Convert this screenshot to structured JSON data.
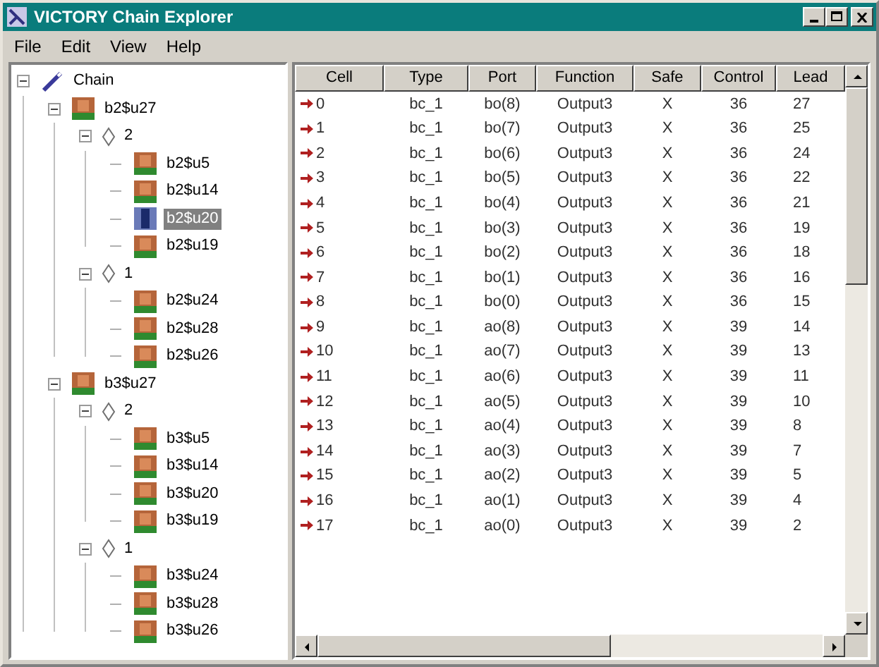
{
  "window": {
    "title": "VICTORY Chain Explorer"
  },
  "menu": [
    "File",
    "Edit",
    "View",
    "Help"
  ],
  "tree": [
    {
      "label": "Chain",
      "kind": "chain",
      "expanded": true,
      "selected": false,
      "children": [
        {
          "label": "b2$u27",
          "kind": "chip",
          "expanded": true,
          "selected": false,
          "children": [
            {
              "label": "2",
              "kind": "group",
              "expanded": true,
              "selected": false,
              "children": [
                {
                  "label": "b2$u5",
                  "kind": "chip",
                  "selected": false
                },
                {
                  "label": "b2$u14",
                  "kind": "chip",
                  "selected": false
                },
                {
                  "label": "b2$u20",
                  "kind": "chip",
                  "selected": true
                },
                {
                  "label": "b2$u19",
                  "kind": "chip",
                  "selected": false
                }
              ]
            },
            {
              "label": "1",
              "kind": "group",
              "expanded": true,
              "selected": false,
              "children": [
                {
                  "label": "b2$u24",
                  "kind": "chip",
                  "selected": false
                },
                {
                  "label": "b2$u28",
                  "kind": "chip",
                  "selected": false
                },
                {
                  "label": "b2$u26",
                  "kind": "chip",
                  "selected": false
                }
              ]
            }
          ]
        },
        {
          "label": "b3$u27",
          "kind": "chip",
          "expanded": true,
          "selected": false,
          "children": [
            {
              "label": "2",
              "kind": "group",
              "expanded": true,
              "selected": false,
              "children": [
                {
                  "label": "b3$u5",
                  "kind": "chip",
                  "selected": false
                },
                {
                  "label": "b3$u14",
                  "kind": "chip",
                  "selected": false
                },
                {
                  "label": "b3$u20",
                  "kind": "chip",
                  "selected": false
                },
                {
                  "label": "b3$u19",
                  "kind": "chip",
                  "selected": false
                }
              ]
            },
            {
              "label": "1",
              "kind": "group",
              "expanded": true,
              "selected": false,
              "children": [
                {
                  "label": "b3$u24",
                  "kind": "chip",
                  "selected": false
                },
                {
                  "label": "b3$u28",
                  "kind": "chip",
                  "selected": false
                },
                {
                  "label": "b3$u26",
                  "kind": "chip",
                  "selected": false
                }
              ]
            }
          ]
        }
      ]
    }
  ],
  "table": {
    "columns": [
      "Cell",
      "Type",
      "Port",
      "Function",
      "Safe",
      "Control",
      "Lead"
    ],
    "rows": [
      [
        "0",
        "bc_1",
        "bo(8)",
        "Output3",
        "X",
        "36",
        "27"
      ],
      [
        "1",
        "bc_1",
        "bo(7)",
        "Output3",
        "X",
        "36",
        "25"
      ],
      [
        "2",
        "bc_1",
        "bo(6)",
        "Output3",
        "X",
        "36",
        "24"
      ],
      [
        "3",
        "bc_1",
        "bo(5)",
        "Output3",
        "X",
        "36",
        "22"
      ],
      [
        "4",
        "bc_1",
        "bo(4)",
        "Output3",
        "X",
        "36",
        "21"
      ],
      [
        "5",
        "bc_1",
        "bo(3)",
        "Output3",
        "X",
        "36",
        "19"
      ],
      [
        "6",
        "bc_1",
        "bo(2)",
        "Output3",
        "X",
        "36",
        "18"
      ],
      [
        "7",
        "bc_1",
        "bo(1)",
        "Output3",
        "X",
        "36",
        "16"
      ],
      [
        "8",
        "bc_1",
        "bo(0)",
        "Output3",
        "X",
        "36",
        "15"
      ],
      [
        "9",
        "bc_1",
        "ao(8)",
        "Output3",
        "X",
        "39",
        "14"
      ],
      [
        "10",
        "bc_1",
        "ao(7)",
        "Output3",
        "X",
        "39",
        "13"
      ],
      [
        "11",
        "bc_1",
        "ao(6)",
        "Output3",
        "X",
        "39",
        "11"
      ],
      [
        "12",
        "bc_1",
        "ao(5)",
        "Output3",
        "X",
        "39",
        "10"
      ],
      [
        "13",
        "bc_1",
        "ao(4)",
        "Output3",
        "X",
        "39",
        "8"
      ],
      [
        "14",
        "bc_1",
        "ao(3)",
        "Output3",
        "X",
        "39",
        "7"
      ],
      [
        "15",
        "bc_1",
        "ao(2)",
        "Output3",
        "X",
        "39",
        "5"
      ],
      [
        "16",
        "bc_1",
        "ao(1)",
        "Output3",
        "X",
        "39",
        "4"
      ],
      [
        "17",
        "bc_1",
        "ao(0)",
        "Output3",
        "X",
        "39",
        "2"
      ]
    ]
  }
}
